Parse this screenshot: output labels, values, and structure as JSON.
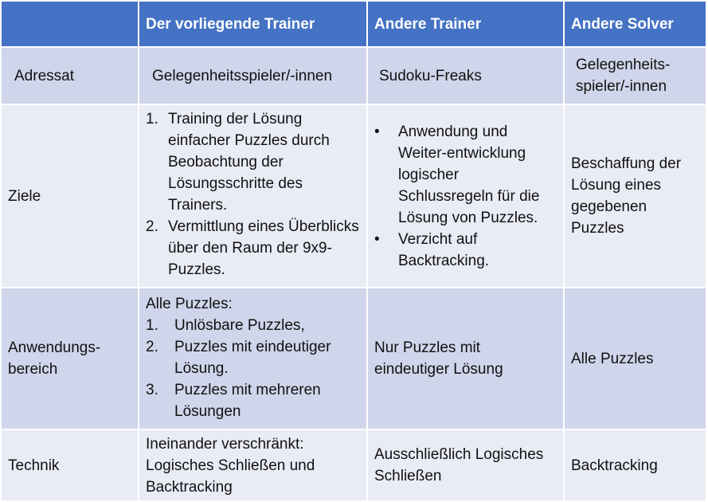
{
  "header": [
    "",
    "Der vorliegende Trainer",
    "Andere Trainer",
    "Andere Solver"
  ],
  "rows": {
    "adressat": {
      "label": "Adressat",
      "c1": "Gelegenheitsspieler/-innen",
      "c2": "Sudoku-Freaks",
      "c3a": "Gelegenheits-",
      "c3b": "spieler/-innen"
    },
    "ziele": {
      "label": "Ziele",
      "c1": [
        {
          "num": "1.",
          "text": "Training der Lösung einfacher Puzzles durch Beobachtung der Lösungsschritte des Trainers."
        },
        {
          "num": "2.",
          "text": "Vermittlung eines Überblicks über den Raum der 9x9-Puzzles."
        }
      ],
      "c2": [
        {
          "bullet": "•",
          "text": "Anwendung und Weiter-entwicklung logischer Schlussregeln für die Lösung von Puzzles."
        },
        {
          "bullet": "•",
          "text": "Verzicht auf Backtracking."
        }
      ],
      "c3": "Beschaffung der Lösung eines gegebenen Puzzles"
    },
    "anwendung": {
      "label": "Anwendungs-bereich",
      "c1_intro": "Alle Puzzles:",
      "c1": [
        {
          "num": "1.",
          "text": "Unlösbare Puzzles,"
        },
        {
          "num": "2.",
          "text": "Puzzles mit eindeutiger Lösung."
        },
        {
          "num": "3.",
          "text": "Puzzles mit mehreren Lösungen"
        }
      ],
      "c2": "Nur Puzzles mit eindeutiger Lösung",
      "c3": "Alle Puzzles"
    },
    "technik": {
      "label": "Technik",
      "c1": "Ineinander verschränkt: Logisches Schließen und Backtracking",
      "c2": "Ausschließlich Logisches Schließen",
      "c3": "Backtracking"
    }
  }
}
